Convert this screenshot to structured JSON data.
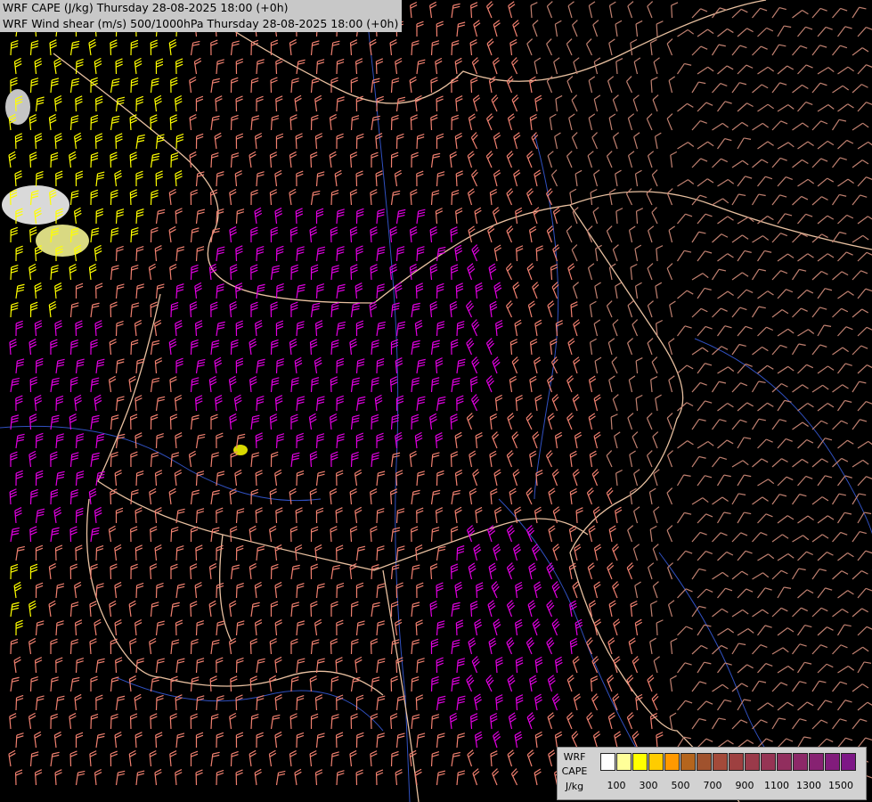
{
  "header": {
    "line1": "WRF CAPE (J/kg) Thursday 28-08-2025 18:00 (+0h)",
    "line2": "WRF Wind shear (m/s) 500/1000hPa Thursday 28-08-2025 18:00 (+0h)"
  },
  "legend": {
    "label_line1": "WRF",
    "label_line2": "CAPE",
    "label_line3": "J/kg",
    "colors": [
      "#ffffff",
      "#ffff99",
      "#ffff00",
      "#ffcc00",
      "#ff9900",
      "#b5651d",
      "#a0522d",
      "#a34a3a",
      "#9e4040",
      "#9a3a4a",
      "#963454",
      "#912e5e",
      "#8c2868",
      "#872272",
      "#821c7c",
      "#7d1686"
    ],
    "ticks": [
      "100",
      "300",
      "500",
      "700",
      "900",
      "1100",
      "1300",
      "1500"
    ]
  },
  "map": {
    "barb_colors": {
      "weak": "#c08070",
      "moderate": "#f08070",
      "strong": "#e000e0",
      "very_strong": "#ffff00"
    },
    "border_color": "#e8c0a0",
    "river_color": "#3050c0"
  }
}
